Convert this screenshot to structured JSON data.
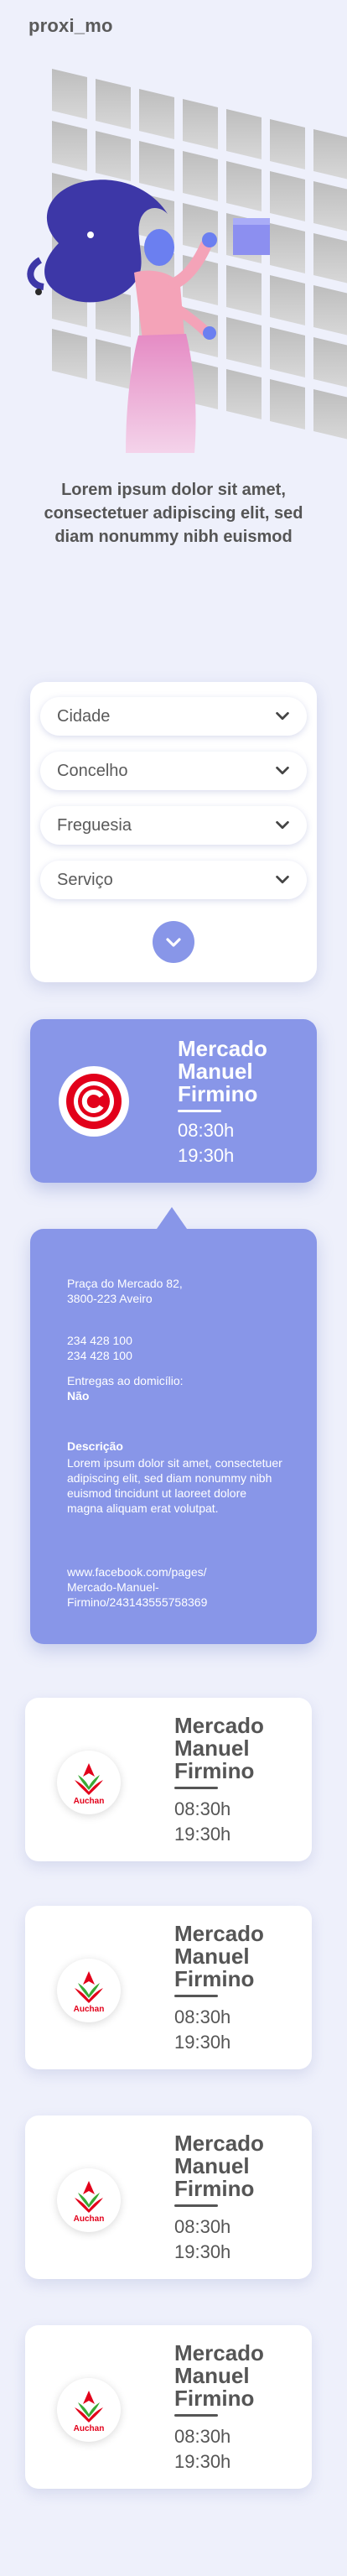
{
  "app": {
    "logo": "proxi_mo"
  },
  "hero": {
    "tagline": "Lorem ipsum dolor sit amet, consectetuer adipiscing elit, sed diam nonummy nibh euismod"
  },
  "filters": [
    {
      "label": "Cidade"
    },
    {
      "label": "Concelho"
    },
    {
      "label": "Freguesia"
    },
    {
      "label": "Serviço"
    }
  ],
  "selected_store": {
    "name_line1": "Mercado",
    "name_line2": "Manuel",
    "name_line3": "Firmino",
    "open": "08:30h",
    "close": "19:30h",
    "logo_icon": "continente-icon"
  },
  "details": {
    "address_line1": "Praça do Mercado 82,",
    "address_line2": "3800-223 Aveiro",
    "phone1": "234 428 100",
    "phone2": "234 428 100",
    "delivery_label": "Entregas ao domicílio:",
    "delivery_value": "Não",
    "description_heading": "Descrição",
    "description_text": "Lorem ipsum dolor sit amet, consectetuer adipiscing elit, sed diam nonummy nibh euismod tincidunt ut laoreet dolore magna aliquam erat volutpat.",
    "link_line1": "www.facebook.com/pages/",
    "link_line2": "Mercado-Manuel-",
    "link_line3": "Firmino/243143555758369"
  },
  "stores": [
    {
      "name_line1": "Mercado",
      "name_line2": "Manuel",
      "name_line3": "Firmino",
      "open": "08:30h",
      "close": "19:30h",
      "logo_text": "Auchan"
    },
    {
      "name_line1": "Mercado",
      "name_line2": "Manuel",
      "name_line3": "Firmino",
      "open": "08:30h",
      "close": "19:30h",
      "logo_text": "Auchan"
    },
    {
      "name_line1": "Mercado",
      "name_line2": "Manuel",
      "name_line3": "Firmino",
      "open": "08:30h",
      "close": "19:30h",
      "logo_text": "Auchan"
    },
    {
      "name_line1": "Mercado",
      "name_line2": "Manuel",
      "name_line3": "Firmino",
      "open": "08:30h",
      "close": "19:30h",
      "logo_text": "Auchan"
    }
  ],
  "colors": {
    "accent": "#8896e8",
    "background": "#eef0fb",
    "text": "#555555",
    "auchan_red": "#e2001a",
    "auchan_green": "#3aa935"
  }
}
